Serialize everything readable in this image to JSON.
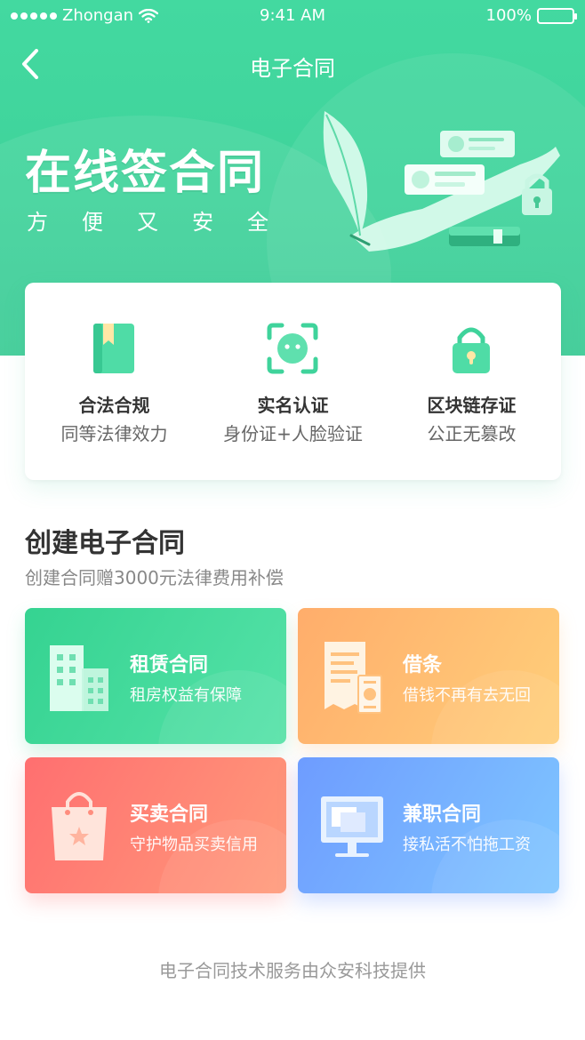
{
  "status_bar": {
    "carrier": "Zhongan",
    "time": "9:41 AM",
    "battery": "100%",
    "icons": [
      "signal-dots-icon",
      "wifi-icon",
      "battery-icon"
    ]
  },
  "nav": {
    "title": "电子合同",
    "back_icon": "chevron-left-icon"
  },
  "hero": {
    "title": "在线签合同",
    "subtitle": "方便又安全"
  },
  "features": [
    {
      "title": "合法合规",
      "desc": "同等法律效力",
      "icon": "book-icon"
    },
    {
      "title": "实名认证",
      "desc": "身份证+人脸验证",
      "icon": "face-scan-icon"
    },
    {
      "title": "区块链存证",
      "desc": "公正无篡改",
      "icon": "lock-icon"
    }
  ],
  "section": {
    "title": "创建电子合同",
    "subtitle": "创建合同赠3000元法律费用补偿"
  },
  "contracts": [
    {
      "title": "租赁合同",
      "desc": "租房权益有保障",
      "icon": "building-icon",
      "color": "#35d391"
    },
    {
      "title": "借条",
      "desc": "借钱不再有去无回",
      "icon": "receipt-money-icon",
      "color": "#ffad6b"
    },
    {
      "title": "买卖合同",
      "desc": "守护物品买卖信用",
      "icon": "shopping-bag-icon",
      "color": "#ff6f70"
    },
    {
      "title": "兼职合同",
      "desc": "接私活不怕拖工资",
      "icon": "monitor-icon",
      "color": "#6e9cff"
    }
  ],
  "footer": "电子合同技术服务由众安科技提供",
  "colors": {
    "brand_green": "#43d9a0",
    "text_primary": "#333333",
    "text_secondary": "#888888"
  }
}
